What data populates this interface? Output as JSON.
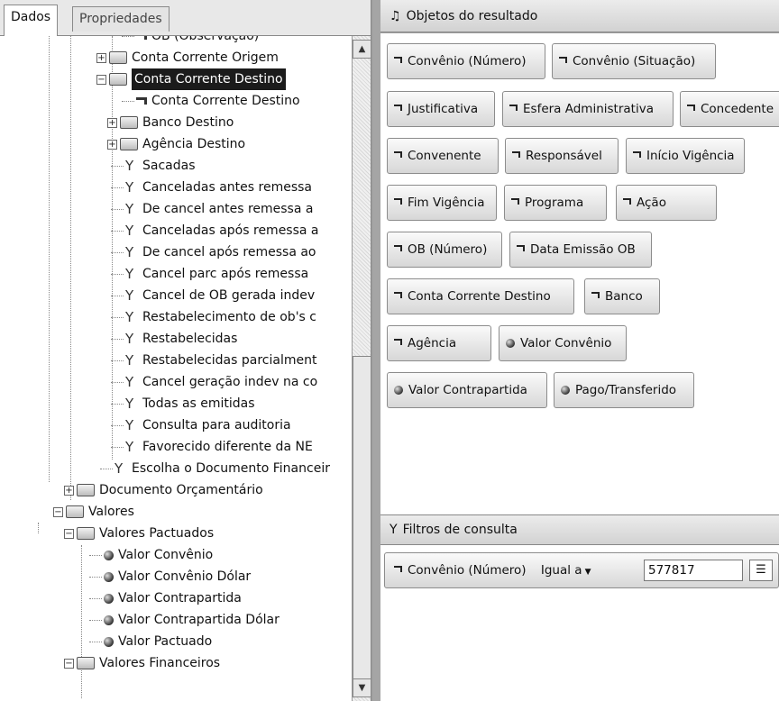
{
  "left_tabs": {
    "data": "Dados",
    "properties": "Propriedades"
  },
  "tree": [
    {
      "label": "OB (Observação)",
      "icon": "dimension",
      "indent": 7,
      "partial": true
    },
    {
      "label": "Conta Corrente Origem",
      "icon": "folder",
      "indent": 6,
      "expander": "+"
    },
    {
      "label": "Conta Corrente Destino",
      "icon": "folder",
      "indent": 6,
      "expander": "−",
      "selected": true
    },
    {
      "label": "Conta Corrente Destino",
      "icon": "dimension",
      "indent": 7
    },
    {
      "label": "Banco Destino",
      "icon": "folder",
      "indent": 7,
      "expander": "+"
    },
    {
      "label": "Agência Destino",
      "icon": "folder",
      "indent": 7,
      "expander": "+"
    },
    {
      "label": "Sacadas",
      "icon": "filter",
      "indent": 6
    },
    {
      "label": "Canceladas antes remessa",
      "icon": "filter",
      "indent": 6
    },
    {
      "label": "De cancel antes remessa a",
      "icon": "filter",
      "indent": 6
    },
    {
      "label": "Canceladas após remessa a",
      "icon": "filter",
      "indent": 6
    },
    {
      "label": "De cancel após remessa ao",
      "icon": "filter",
      "indent": 6
    },
    {
      "label": "Cancel parc após remessa",
      "icon": "filter",
      "indent": 6
    },
    {
      "label": "Cancel de OB gerada indev",
      "icon": "filter",
      "indent": 6
    },
    {
      "label": "Restabelecimento de ob's c",
      "icon": "filter",
      "indent": 6
    },
    {
      "label": "Restabelecidas",
      "icon": "filter",
      "indent": 6
    },
    {
      "label": "Restabelecidas parcialment",
      "icon": "filter",
      "indent": 6
    },
    {
      "label": "Cancel geração indev na co",
      "icon": "filter",
      "indent": 6
    },
    {
      "label": "Todas as emitidas",
      "icon": "filter",
      "indent": 6
    },
    {
      "label": "Consulta para auditoria",
      "icon": "filter",
      "indent": 6
    },
    {
      "label": "Favorecido diferente da NE",
      "icon": "filter",
      "indent": 6
    },
    {
      "label": "Escolha o Documento Financeir",
      "icon": "filter",
      "indent": 5
    },
    {
      "label": "Documento Orçamentário",
      "icon": "folder",
      "indent": 3,
      "expander": "+"
    },
    {
      "label": "Valores",
      "icon": "folder",
      "indent": 2,
      "expander": "−"
    },
    {
      "label": "Valores Pactuados",
      "icon": "folder",
      "indent": 3,
      "expander": "−"
    },
    {
      "label": "Valor Convênio",
      "icon": "measure",
      "indent": 4
    },
    {
      "label": "Valor Convênio Dólar",
      "icon": "measure",
      "indent": 4
    },
    {
      "label": "Valor Contrapartida",
      "icon": "measure",
      "indent": 4
    },
    {
      "label": "Valor Contrapartida Dólar",
      "icon": "measure",
      "indent": 4
    },
    {
      "label": "Valor Pactuado",
      "icon": "measure",
      "indent": 4
    },
    {
      "label": "Valores Financeiros",
      "icon": "folder",
      "indent": 3,
      "expander": "−"
    }
  ],
  "results_panel": {
    "title": "Objetos do resultado",
    "chips": [
      {
        "label": "Convênio (Número)",
        "icon": "dimension"
      },
      {
        "label": "Convênio (Situação)",
        "icon": "dimension"
      },
      {
        "label": "Justificativa",
        "icon": "dimension"
      },
      {
        "label": "Esfera Administrativa",
        "icon": "dimension"
      },
      {
        "label": "Concedente",
        "icon": "dimension"
      },
      {
        "label": "Convenente",
        "icon": "dimension"
      },
      {
        "label": "Responsável",
        "icon": "dimension"
      },
      {
        "label": "Início Vigência",
        "icon": "dimension"
      },
      {
        "label": "Fim Vigência",
        "icon": "dimension"
      },
      {
        "label": "Programa",
        "icon": "dimension"
      },
      {
        "label": "Ação",
        "icon": "dimension"
      },
      {
        "label": "OB (Número)",
        "icon": "dimension"
      },
      {
        "label": "Data Emissão OB",
        "icon": "dimension"
      },
      {
        "label": "Conta Corrente Destino",
        "icon": "dimension"
      },
      {
        "label": "Banco",
        "icon": "dimension"
      },
      {
        "label": "Agência",
        "icon": "dimension"
      },
      {
        "label": "Valor Convênio",
        "icon": "measure"
      },
      {
        "label": "Valor Contrapartida",
        "icon": "measure"
      },
      {
        "label": "Pago/Transferido",
        "icon": "measure"
      }
    ]
  },
  "filters_panel": {
    "title": "Filtros de consulta",
    "filter": {
      "object": "Convênio (Número)",
      "operator": "Igual a",
      "value": "577817"
    }
  }
}
